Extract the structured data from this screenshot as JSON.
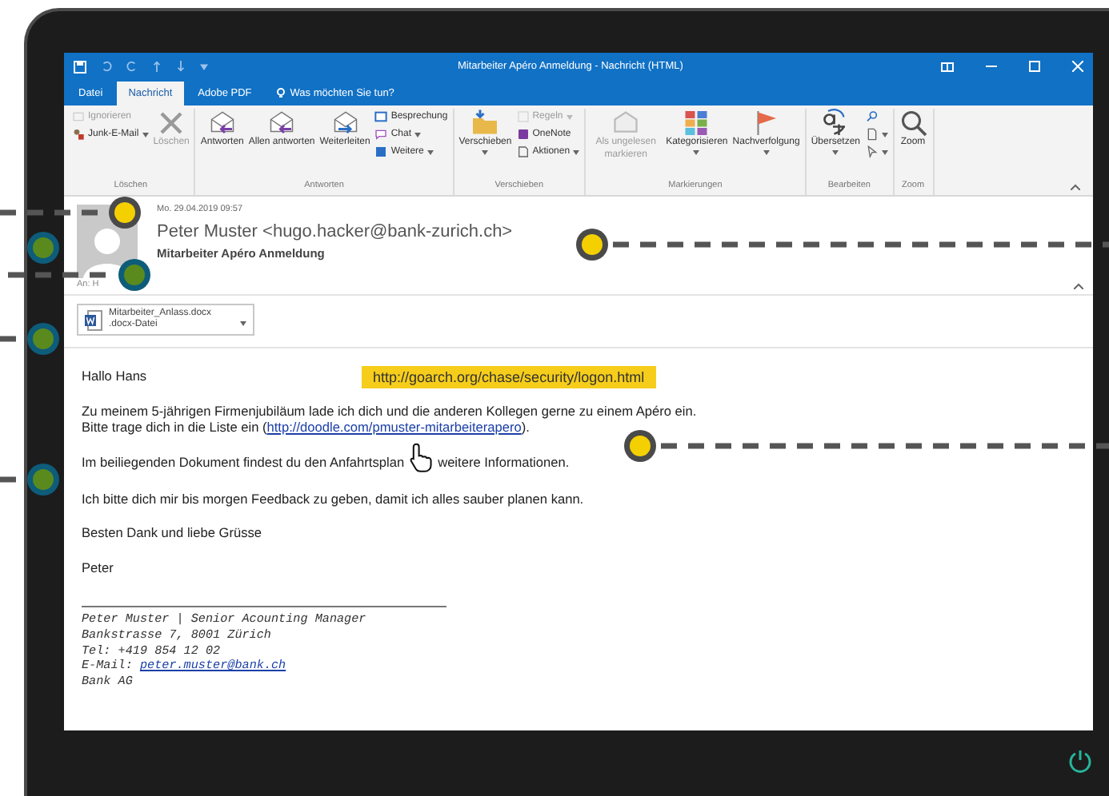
{
  "window": {
    "title": "Mitarbeiter Apéro Anmeldung - Nachricht (HTML)"
  },
  "tabs": [
    {
      "label": "Datei",
      "selected": false,
      "kind": "tab"
    },
    {
      "label": "Nachricht",
      "selected": true,
      "kind": "tab"
    },
    {
      "label": "Adobe PDF",
      "selected": false,
      "kind": "tab"
    },
    {
      "label": "Was möchten Sie tun?",
      "selected": false,
      "kind": "tell"
    }
  ],
  "ribbon_groups": [
    {
      "label": "Löschen",
      "items": [
        {
          "kind": "small",
          "label": "Ignorieren",
          "disabled": true,
          "dropdown": false
        },
        {
          "kind": "small",
          "label": "Junk-E-Mail",
          "disabled": false,
          "dropdown": true
        },
        {
          "kind": "large",
          "label": "Löschen",
          "disabled": true,
          "dropdown": false
        }
      ]
    },
    {
      "label": "Antworten",
      "items": [
        {
          "kind": "large",
          "label": "Antworten",
          "disabled": false,
          "dropdown": false
        },
        {
          "kind": "large",
          "label": "Allen antworten",
          "disabled": false,
          "dropdown": false
        },
        {
          "kind": "large",
          "label": "Weiterleiten",
          "disabled": false,
          "dropdown": false
        },
        {
          "kind": "small",
          "label": "Besprechung",
          "disabled": false,
          "dropdown": false
        },
        {
          "kind": "small",
          "label": "Chat",
          "disabled": false,
          "dropdown": true
        },
        {
          "kind": "small",
          "label": "Weitere",
          "disabled": false,
          "dropdown": true
        }
      ]
    },
    {
      "label": "Verschieben",
      "items": [
        {
          "kind": "large",
          "label": "Verschieben",
          "disabled": false,
          "dropdown": true
        },
        {
          "kind": "small",
          "label": "Regeln",
          "disabled": true,
          "dropdown": true
        },
        {
          "kind": "small",
          "label": "OneNote",
          "disabled": false,
          "dropdown": false
        },
        {
          "kind": "small",
          "label": "Aktionen",
          "disabled": false,
          "dropdown": true
        }
      ]
    },
    {
      "label": "Markierungen",
      "items": [
        {
          "kind": "large",
          "label": "Als ungelesen markieren",
          "disabled": true,
          "dropdown": false
        },
        {
          "kind": "large",
          "label": "Kategorisieren",
          "disabled": false,
          "dropdown": true
        },
        {
          "kind": "large",
          "label": "Nachverfolgung",
          "disabled": false,
          "dropdown": true
        }
      ]
    },
    {
      "label": "Bearbeiten",
      "items": [
        {
          "kind": "large",
          "label": "Übersetzen",
          "disabled": false,
          "dropdown": true
        },
        {
          "kind": "small",
          "disabled": false,
          "dropdown": false
        },
        {
          "kind": "small",
          "disabled": false,
          "dropdown": true
        },
        {
          "kind": "small",
          "disabled": false,
          "dropdown": true
        }
      ]
    },
    {
      "label": "Zoom",
      "items": [
        {
          "kind": "large",
          "label": "Zoom",
          "disabled": false,
          "dropdown": false
        }
      ]
    }
  ],
  "message": {
    "date": "Mo. 29.04.2019 09:57",
    "sender": "Peter Muster <hugo.hacker@bank-zurich.ch>",
    "subject": "Mitarbeiter Apéro Anmeldung",
    "to": "An: H",
    "attachment": {
      "name": "Mitarbeiter_Anlass.docx",
      "type": ".docx-Datei"
    }
  },
  "link_tooltip": "http://goarch.org/chase/security/logon.html",
  "body": [
    {
      "text": "Hallo Hans"
    },
    {
      "lines": [
        {
          "text": "Zu meinem 5-jährigen Firmenjubiläum lade ich dich und die anderen Kollegen gerne zu einem Apéro ein."
        },
        {
          "text": "Bitte trage dich in die Liste ein (",
          "link": "http://doodle.com/pmuster-mitarbeiterapero",
          "after": ")."
        }
      ]
    },
    {
      "parts": [
        "Im beiliegenden Dokument findest du den Anfahrtsplan",
        "weitere Informationen."
      ]
    },
    {
      "text": "Ich bitte dich mir bis morgen Feedback zu geben, damit ich alles sauber planen kann."
    },
    {
      "text": "Besten Dank und liebe Grüsse"
    },
    {
      "text": "Peter"
    }
  ],
  "signature": [
    {
      "text": "Peter Muster | Senior Acounting Manager"
    },
    {
      "text": "Bankstrasse 7, 8001 Zürich"
    },
    {
      "text": "Tel: +419 854 12 02"
    },
    {
      "text": "E-Mail: ",
      "link": "peter.muster@bank.ch"
    },
    {
      "text": "Bank AG"
    }
  ],
  "markers": [
    {
      "color": "#f5d000"
    },
    {
      "color": "#5a8a1e"
    },
    {
      "color": "#5a8a1e"
    },
    {
      "color": "#5a8a1e"
    },
    {
      "color": "#5a8a1e"
    },
    {
      "color": "#f5d000"
    },
    {
      "color": "#f5d000"
    }
  ]
}
